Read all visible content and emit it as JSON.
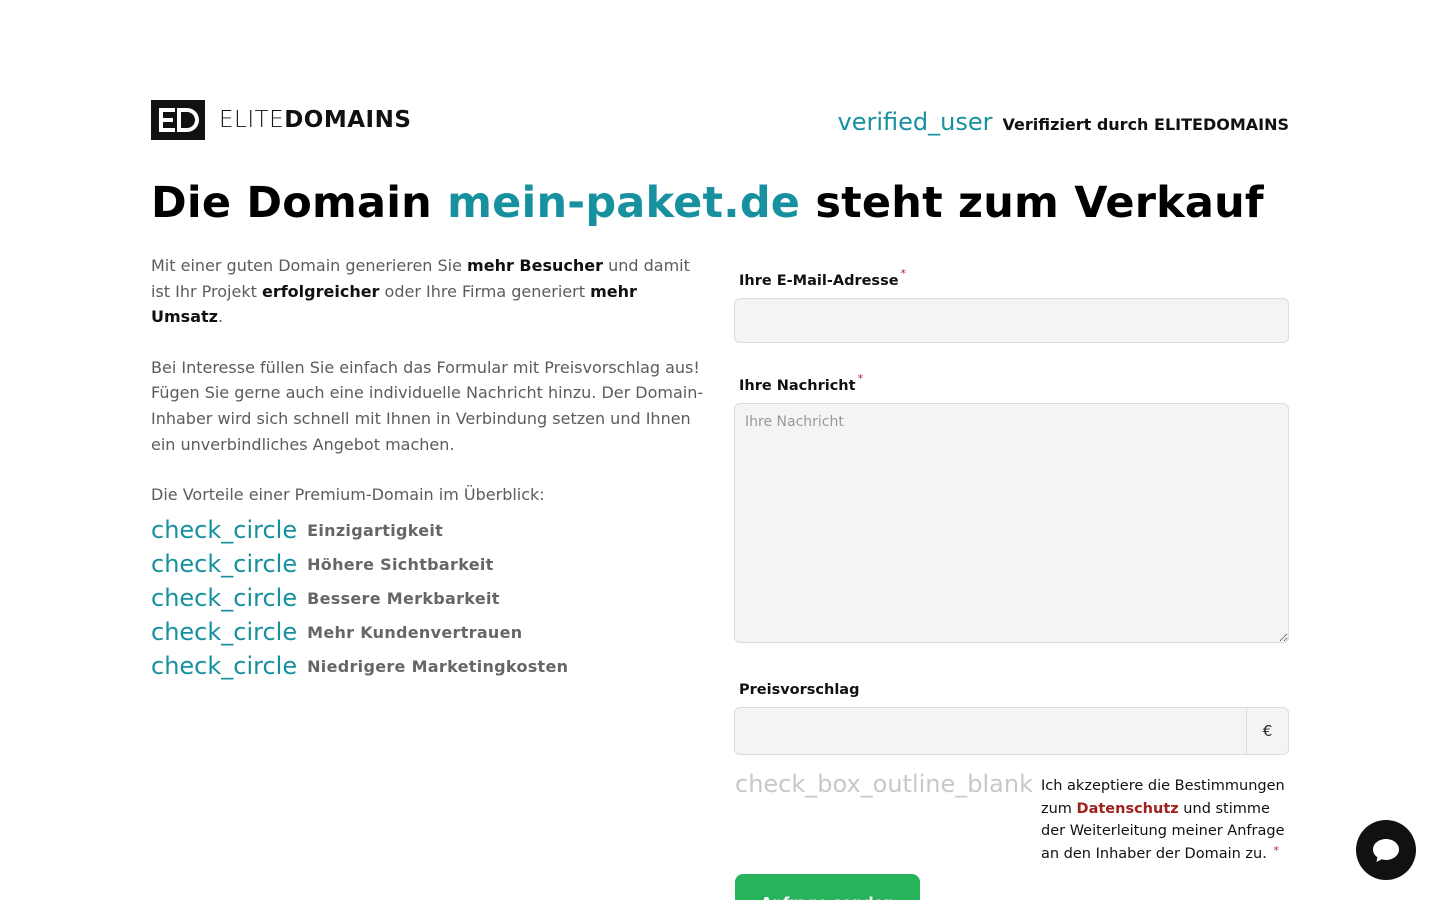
{
  "brand": {
    "name_light": "ELITE",
    "name_bold": "DOMAINS"
  },
  "verified": {
    "icon": "verified_user",
    "text": "Verifiziert durch ELITEDOMAINS"
  },
  "headline": {
    "prefix": "Die Domain ",
    "domain": "mein-paket.de",
    "suffix": " steht zum Verkauf"
  },
  "intro": {
    "p1_a": "Mit einer guten Domain generieren Sie ",
    "p1_b": "mehr Besucher",
    "p1_c": " und damit ist Ihr Projekt ",
    "p1_d": "erfolgreicher",
    "p1_e": " oder Ihre Firma generiert ",
    "p1_f": "mehr Umsatz",
    "p1_g": ".",
    "p2": "Bei Interesse füllen Sie einfach das Formular mit Preisvorschlag aus! Fügen Sie gerne auch eine individuelle Nachricht hinzu. Der Domain-Inhaber wird sich schnell mit Ihnen in Verbindung setzen und Ihnen ein unverbindliches Angebot machen.",
    "benefits_intro": "Die Vorteile einer Premium-Domain im Überblick:"
  },
  "benefits": [
    {
      "icon": "check_circle",
      "label": "Einzigartigkeit"
    },
    {
      "icon": "check_circle",
      "label": "Höhere Sichtbarkeit"
    },
    {
      "icon": "check_circle",
      "label": "Bessere Merkbarkeit"
    },
    {
      "icon": "check_circle",
      "label": "Mehr Kundenvertrauen"
    },
    {
      "icon": "check_circle",
      "label": "Niedrigere Marketingkosten"
    }
  ],
  "form": {
    "email_label": "Ihre E-Mail-Adresse",
    "email_value": "",
    "message_label": "Ihre Nachricht",
    "message_placeholder": "Ihre Nachricht",
    "price_label": "Preisvorschlag",
    "price_value": "",
    "currency": "€",
    "required_mark": "*"
  },
  "consent": {
    "icon": "check_box_outline_blank",
    "text_a": "Ich akzeptiere die Bestimmungen zum ",
    "link": "Datenschutz",
    "text_b": " und stimme der Weiterleitung meiner Anfrage an den Inhaber der Domain zu.",
    "required_mark": "*"
  },
  "submit_label": "Anfrage senden",
  "colors": {
    "accent": "#17919f",
    "submit": "#27b35a",
    "link": "#a0201c"
  }
}
